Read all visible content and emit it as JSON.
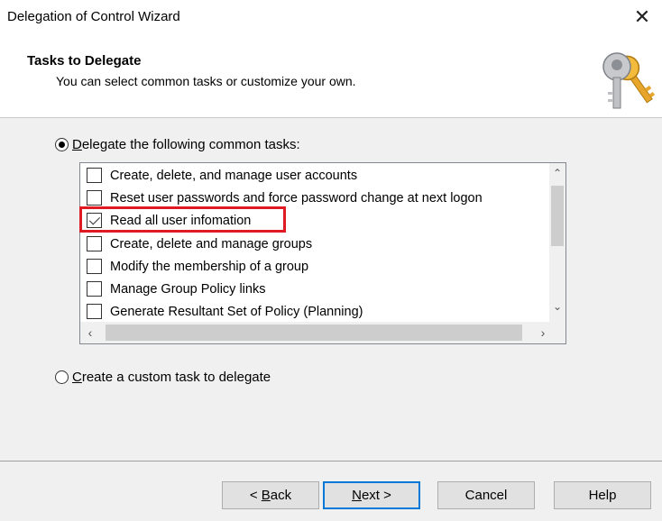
{
  "window": {
    "title": "Delegation of Control Wizard",
    "close_icon": "close-icon"
  },
  "header": {
    "title": "Tasks to Delegate",
    "subtitle": "You can select common tasks or customize your own.",
    "icon": "keys-icon"
  },
  "options": {
    "common": {
      "label_access": "D",
      "label_rest": "elegate the following common tasks:",
      "selected": true
    },
    "custom": {
      "label_access": "C",
      "label_rest": "reate a custom task to delegate",
      "selected": false
    }
  },
  "tasks": [
    {
      "label": "Create, delete, and manage user accounts",
      "checked": false
    },
    {
      "label": "Reset user passwords and force password change at next logon",
      "checked": false
    },
    {
      "label": "Read all user infomation",
      "checked": true
    },
    {
      "label": "Create, delete and manage groups",
      "checked": false
    },
    {
      "label": "Modify the membership of a group",
      "checked": false
    },
    {
      "label": "Manage Group Policy links",
      "checked": false
    },
    {
      "label": "Generate Resultant Set of Policy (Planning)",
      "checked": false
    }
  ],
  "scroll": {
    "up": "^",
    "down": "v",
    "left": "<",
    "right": ">"
  },
  "buttons": {
    "back": {
      "prefix": "< ",
      "access": "B",
      "rest": "ack"
    },
    "next": {
      "access": "N",
      "rest": "ext >"
    },
    "cancel": "Cancel",
    "help": "Help"
  },
  "colors": {
    "highlight": "#e01a22",
    "default_button_border": "#0078d7"
  }
}
